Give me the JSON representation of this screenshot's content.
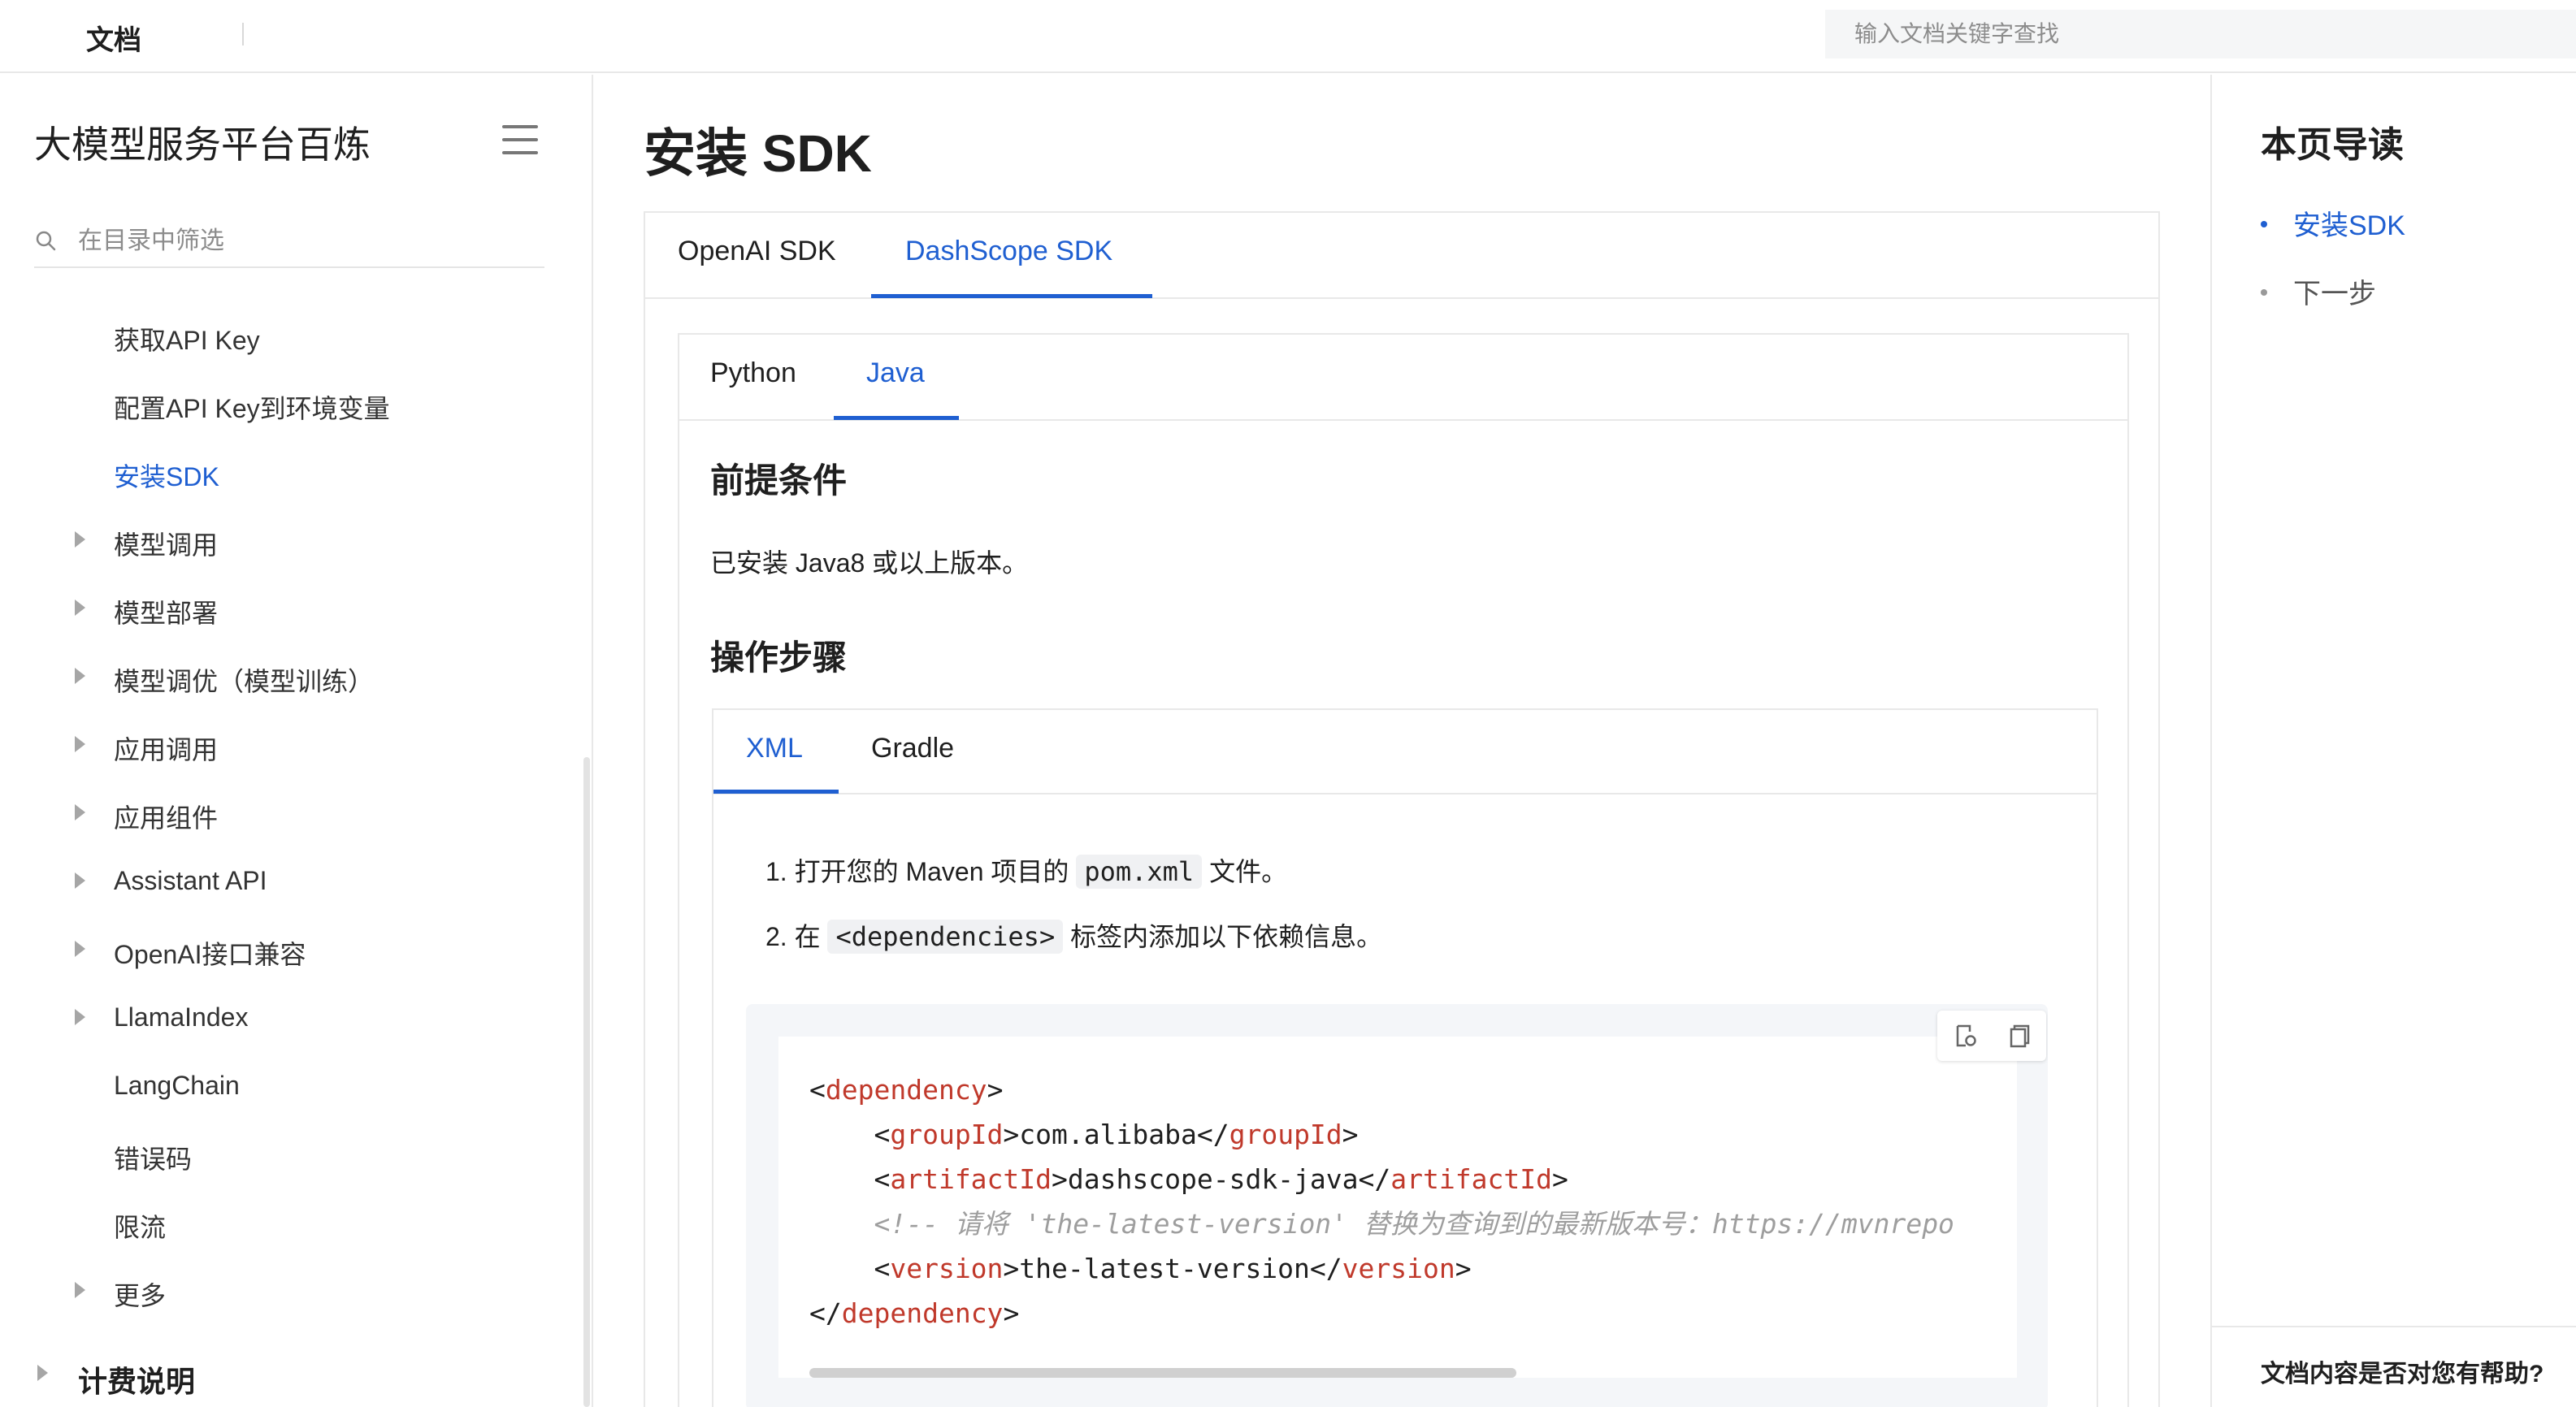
{
  "header": {
    "brand": "文档",
    "search_placeholder": "输入文档关键字查找"
  },
  "sidebar": {
    "title": "大模型服务平台百炼",
    "filter_placeholder": "在目录中筛选",
    "items": [
      {
        "label": "获取API Key"
      },
      {
        "label": "配置API Key到环境变量"
      },
      {
        "label": "安装SDK"
      },
      {
        "label": "模型调用"
      },
      {
        "label": "模型部署"
      },
      {
        "label": "模型调优（模型训练）"
      },
      {
        "label": "应用调用"
      },
      {
        "label": "应用组件"
      },
      {
        "label": "Assistant API"
      },
      {
        "label": "OpenAI接口兼容"
      },
      {
        "label": "LlamaIndex"
      },
      {
        "label": "LangChain"
      },
      {
        "label": "错误码"
      },
      {
        "label": "限流"
      },
      {
        "label": "更多"
      },
      {
        "label": "计费说明"
      }
    ]
  },
  "main": {
    "title": "安装 SDK",
    "sdk_tabs": [
      "OpenAI SDK",
      "DashScope SDK"
    ],
    "lang_tabs": [
      "Python",
      "Java"
    ],
    "prereq_heading": "前提条件",
    "prereq_text": "已安装 Java8 或以上版本。",
    "steps_heading": "操作步骤",
    "build_tabs": [
      "XML",
      "Gradle"
    ],
    "step1": {
      "prefix": "1. 打开您的 Maven 项目的",
      "code": "pom.xml",
      "suffix": "文件。"
    },
    "step2": {
      "prefix": "2. 在",
      "code": "<dependencies>",
      "suffix": "标签内添加以下依赖信息。"
    },
    "code": {
      "line1_open": "<",
      "line1_tag": "dependency",
      "line1_close": ">",
      "group_tag": "groupId",
      "group_value": "com.alibaba",
      "artifact_tag": "artifactId",
      "artifact_value": "dashscope-sdk-java",
      "comment": "<!-- 请将 'the-latest-version' 替换为查询到的最新版本号：https://mvnrepo",
      "version_tag": "version",
      "version_value": "the-latest-version",
      "end_tag": "dependency"
    }
  },
  "toc": {
    "title": "本页导读",
    "items": [
      "安装SDK",
      "下一步"
    ],
    "feedback": "文档内容是否对您有帮助?"
  }
}
